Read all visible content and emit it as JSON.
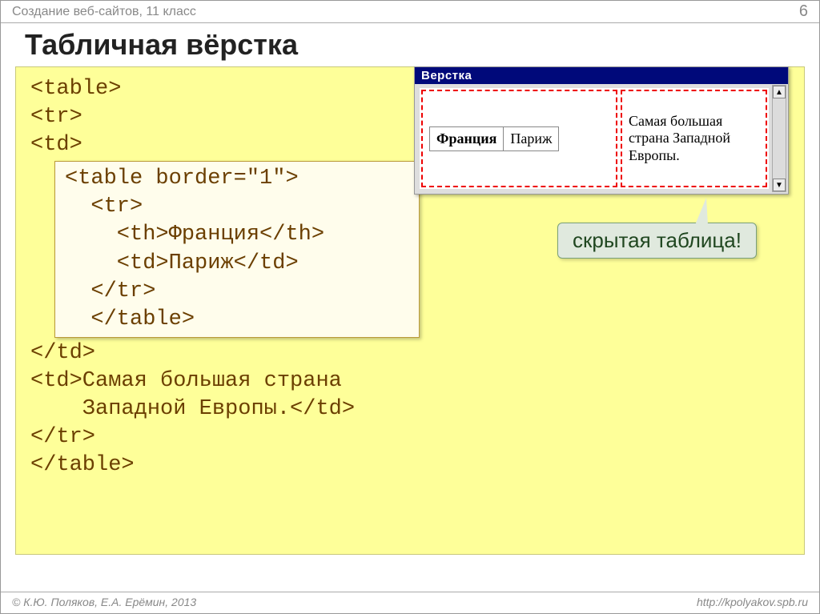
{
  "header": {
    "course": "Создание веб-сайтов, 11 класс",
    "page": "6"
  },
  "title": "Табличная вёрстка",
  "code": {
    "l1": "<table>",
    "l2": "<tr>",
    "l3": "<td>",
    "inner1": "<table border=\"1\">",
    "inner2": "  <tr>",
    "inner3": "    <th>Франция</th>",
    "inner4": "    <td>Париж</td>",
    "inner5": "  </tr>",
    "inner6": "  </table>",
    "l4": "</td>",
    "l5": "<td>Самая большая страна",
    "l6": "    Западной Европы.</td>",
    "l7": "</tr>",
    "l8": "</table>"
  },
  "preview": {
    "title": "Верстка",
    "th": "Франция",
    "td": "Париж",
    "desc": "Самая большая страна Западной Европы."
  },
  "callout": "скрытая таблица!",
  "footer": {
    "left": "© К.Ю. Поляков, Е.А. Ерёмин, 2013",
    "right": "http://kpolyakov.spb.ru"
  }
}
